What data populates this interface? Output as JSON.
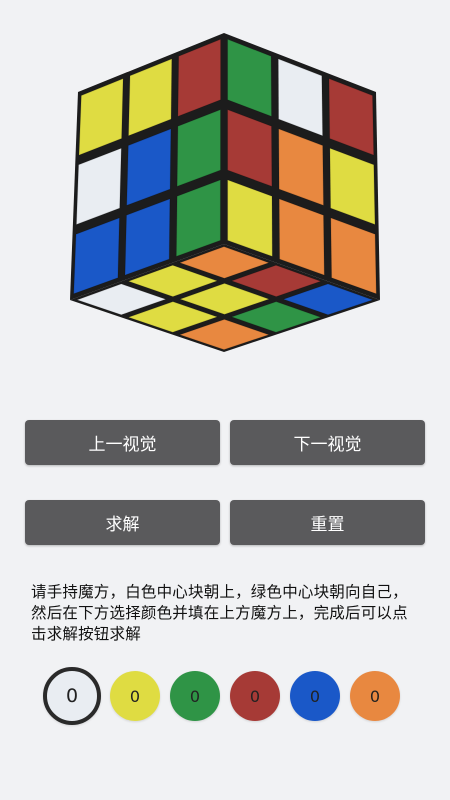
{
  "colors": {
    "white": "#e9edf2",
    "yellow": "#dfdc42",
    "green": "#2f9446",
    "red": "#a63a36",
    "blue": "#1a58c8",
    "orange": "#e88840",
    "body": "#1c1c1c"
  },
  "cube": {
    "left_face": [
      [
        "yellow",
        "yellow",
        "red"
      ],
      [
        "white",
        "blue",
        "green"
      ],
      [
        "blue",
        "blue",
        "green"
      ]
    ],
    "right_face": [
      [
        "green",
        "white",
        "red"
      ],
      [
        "red",
        "orange",
        "yellow"
      ],
      [
        "yellow",
        "orange",
        "orange"
      ]
    ],
    "bottom_face": [
      [
        "orange",
        "red",
        "blue"
      ],
      [
        "yellow",
        "yellow",
        "green"
      ],
      [
        "white",
        "yellow",
        "orange"
      ]
    ]
  },
  "buttons": {
    "prev_view": "上一视觉",
    "next_view": "下一视觉",
    "solve": "求解",
    "reset": "重置"
  },
  "instruction": "请手持魔方，白色中心块朝上，绿色中心块朝向自己，然后在下方选择颜色并填在上方魔方上，完成后可以点击求解按钮求解",
  "palette": [
    {
      "color": "white",
      "count": "0",
      "selected": true
    },
    {
      "color": "yellow",
      "count": "0",
      "selected": false
    },
    {
      "color": "green",
      "count": "0",
      "selected": false
    },
    {
      "color": "red",
      "count": "0",
      "selected": false
    },
    {
      "color": "blue",
      "count": "0",
      "selected": false
    },
    {
      "color": "orange",
      "count": "0",
      "selected": false
    }
  ]
}
